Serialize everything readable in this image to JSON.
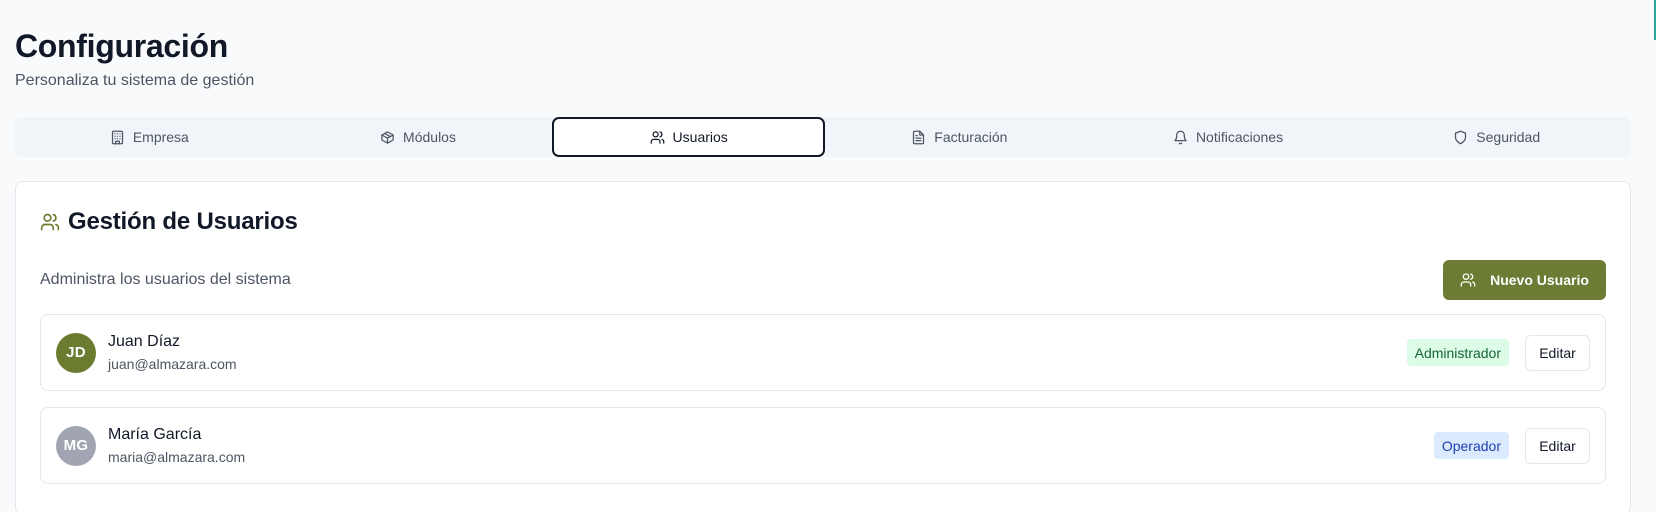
{
  "header": {
    "title": "Configuración",
    "subtitle": "Personaliza tu sistema de gestión"
  },
  "tabs": [
    {
      "label": "Empresa",
      "icon": "building-icon",
      "active": false
    },
    {
      "label": "Módulos",
      "icon": "package-icon",
      "active": false
    },
    {
      "label": "Usuarios",
      "icon": "users-icon",
      "active": true
    },
    {
      "label": "Facturación",
      "icon": "file-text-icon",
      "active": false
    },
    {
      "label": "Notificaciones",
      "icon": "bell-icon",
      "active": false
    },
    {
      "label": "Seguridad",
      "icon": "shield-icon",
      "active": false
    }
  ],
  "users_card": {
    "title": "Gestión de Usuarios",
    "description": "Administra los usuarios del sistema",
    "new_user_label": "Nuevo Usuario",
    "users": [
      {
        "initials": "JD",
        "name": "Juan Díaz",
        "email": "juan@almazara.com",
        "role": "Administrador",
        "edit_label": "Editar"
      },
      {
        "initials": "MG",
        "name": "María García",
        "email": "maria@almazara.com",
        "role": "Operador",
        "edit_label": "Editar"
      }
    ]
  },
  "colors": {
    "accent": "#6d7c35",
    "avatar_admin": "#6b7c31",
    "avatar_operator": "#a1a5b1",
    "badge_admin_bg": "#dcfce7",
    "badge_admin_text": "#166534",
    "badge_operator_bg": "#dbeafe",
    "badge_operator_text": "#1e40af"
  }
}
